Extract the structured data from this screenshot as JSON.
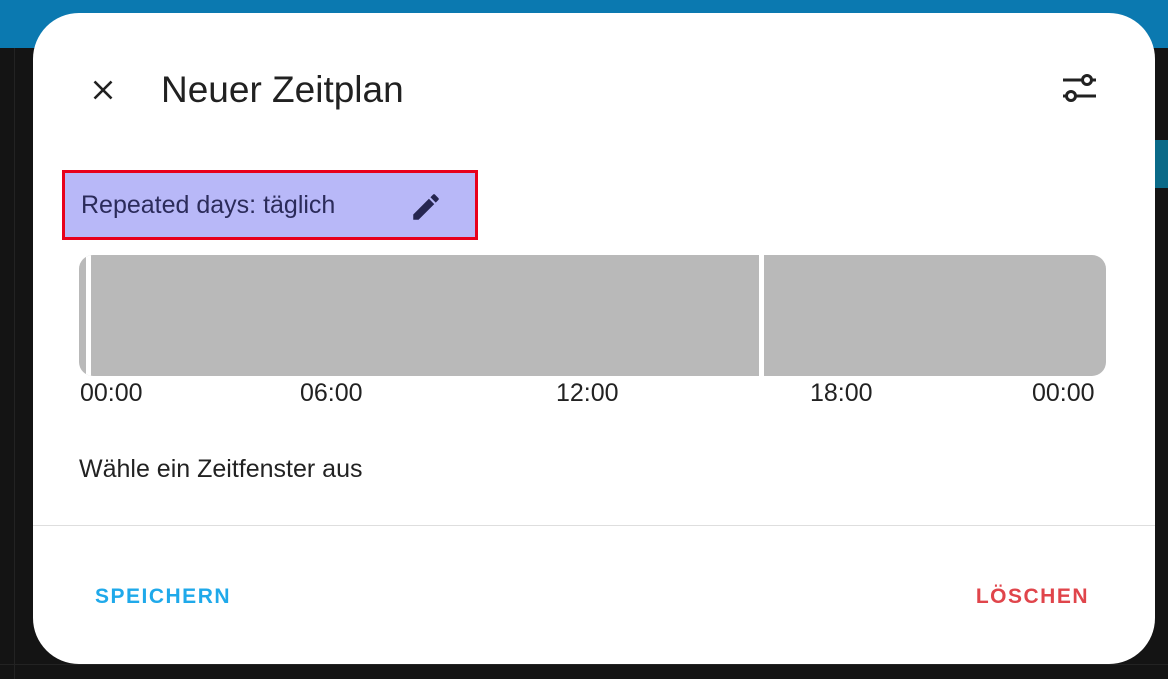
{
  "dialog": {
    "title": "Neuer Zeitplan",
    "close_icon": "close-icon",
    "options_icon": "tune-icon"
  },
  "repeat": {
    "label": "Repeated days: täglich",
    "edit_icon": "pencil-icon"
  },
  "timeline": {
    "ticks": [
      "00:00",
      "06:00",
      "12:00",
      "18:00",
      "00:00"
    ]
  },
  "hint": "Wähle ein Zeitfenster aus",
  "actions": {
    "save_label": "SPEICHERN",
    "delete_label": "LÖSCHEN"
  },
  "colors": {
    "accent": "#1fa9ea",
    "danger": "#e0454b",
    "highlight": "#b8b8f8",
    "highlight_border": "#e8001c",
    "timeline_fill": "#b9b9b9"
  }
}
